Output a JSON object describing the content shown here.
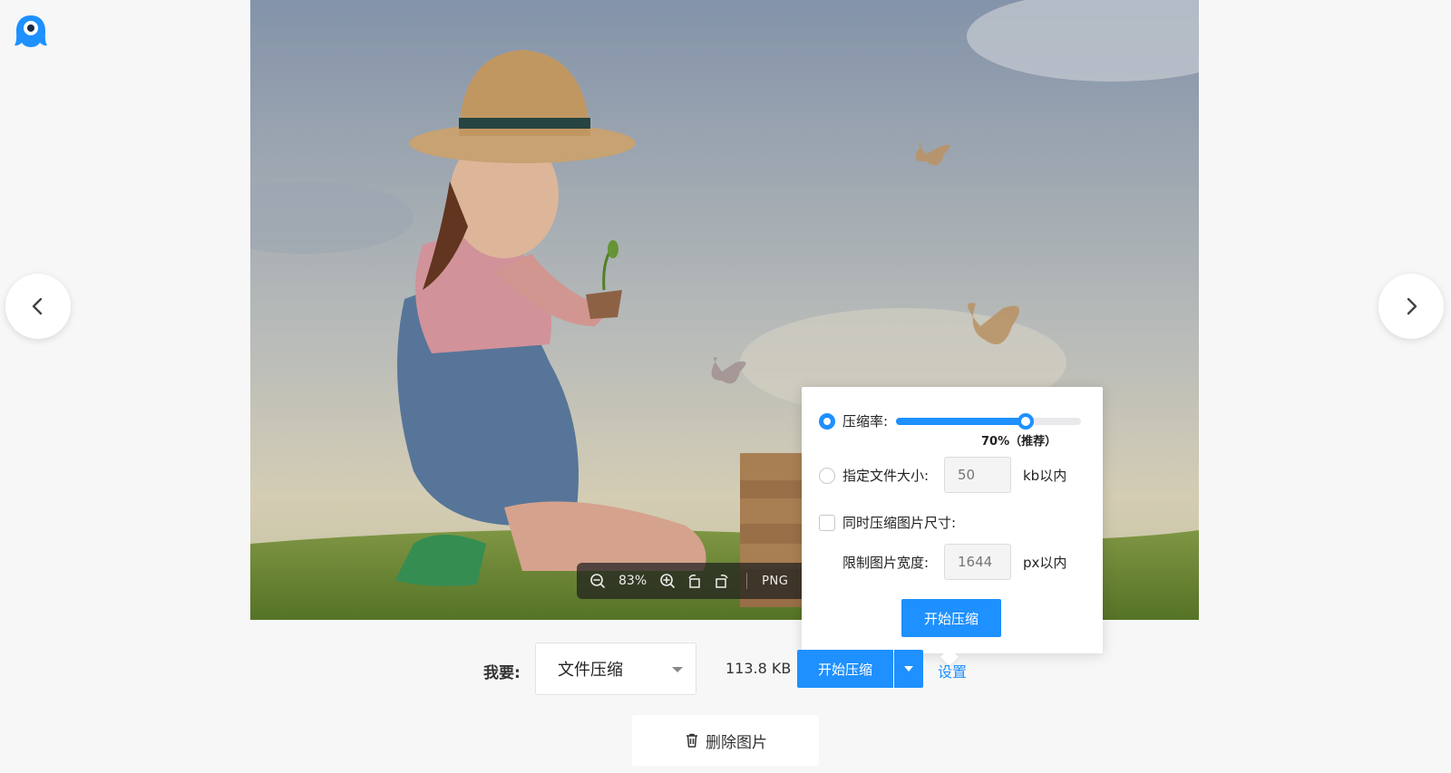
{
  "app": {
    "logo_icon": "mascot-logo-icon",
    "accent_color": "#1e90ff"
  },
  "navigation": {
    "prev_icon": "chevron-left-icon",
    "next_icon": "chevron-right-icon"
  },
  "image_viewer": {
    "zoom_level": "83%",
    "format": "PNG",
    "tools": [
      "zoom-out-icon",
      "zoom-in-icon",
      "rotate-left-icon",
      "rotate-right-icon"
    ]
  },
  "settings_panel": {
    "compression_rate_label": "压缩率:",
    "compression_rate_value": 0.7,
    "compression_rate_note": "70%（推荐）",
    "file_size_label": "指定文件大小:",
    "file_size_placeholder": "50",
    "file_size_unit": "kb以内",
    "resize_label": "同时压缩图片尺寸:",
    "width_limit_label": "限制图片宽度:",
    "width_limit_placeholder": "1644",
    "width_limit_unit": "px以内",
    "start_button": "开始压缩",
    "selected_option": "compression_rate",
    "resize_checked": false
  },
  "bottom_bar": {
    "want_label": "我要:",
    "mode_value": "文件压缩",
    "file_size": "113.8 KB",
    "start_button": "开始压缩",
    "settings_link": "设置",
    "delete_button": "删除图片"
  }
}
